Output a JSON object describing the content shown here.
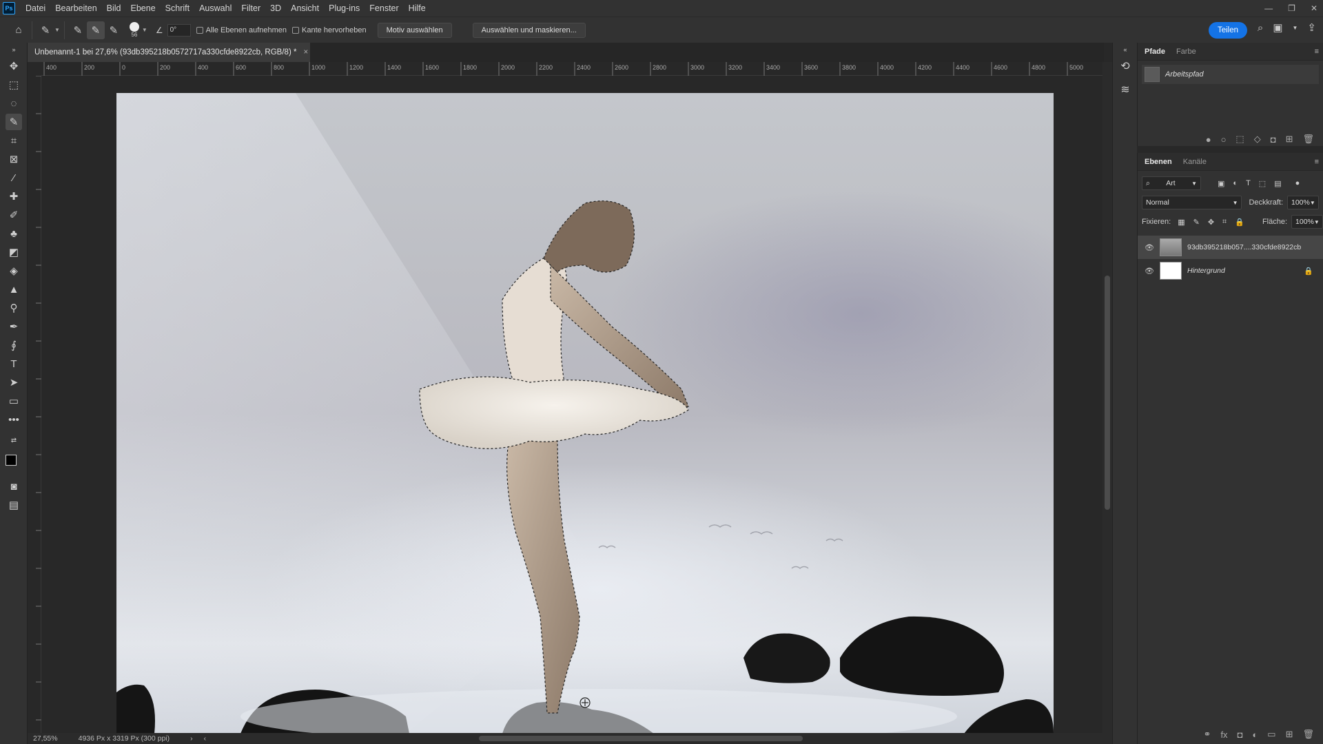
{
  "menubar": {
    "logo": "Ps",
    "items": [
      "Datei",
      "Bearbeiten",
      "Bild",
      "Ebene",
      "Schrift",
      "Auswahl",
      "Filter",
      "3D",
      "Ansicht",
      "Plug-ins",
      "Fenster",
      "Hilfe"
    ]
  },
  "options": {
    "brush_size": "56",
    "angle_value": "0°",
    "sample_all_layers": "Alle Ebenen aufnehmen",
    "enhance_edge": "Kante hervorheben",
    "select_subject": "Motiv auswählen",
    "select_and_mask": "Auswählen und maskieren...",
    "share": "Teilen"
  },
  "document": {
    "tab_title": "Unbenannt-1 bei 27,6% (93db395218b0572717a330cfde8922cb, RGB/8) *",
    "ruler_labels": [
      "400",
      "200",
      "0",
      "200",
      "400",
      "600",
      "800",
      "1000",
      "1200",
      "1400",
      "1600",
      "1800",
      "2000",
      "2200",
      "2400",
      "2600",
      "2800",
      "3000",
      "3200",
      "3400",
      "3600",
      "3800",
      "4000",
      "4200",
      "4400",
      "4600",
      "4800",
      "5000"
    ]
  },
  "status": {
    "zoom": "27,55%",
    "dimensions": "4936 Px x 3319 Px (300 ppi)"
  },
  "paths_panel": {
    "tabs": [
      "Pfade",
      "Farbe"
    ],
    "path_name": "Arbeitspfad"
  },
  "layers_panel": {
    "tabs": [
      "Ebenen",
      "Kanäle"
    ],
    "filter_label": "Art",
    "blend_mode": "Normal",
    "opacity_label": "Deckkraft:",
    "opacity_value": "100%",
    "lock_label": "Fixieren:",
    "fill_label": "Fläche:",
    "fill_value": "100%",
    "layers": [
      {
        "name": "93db395218b057....330cfde8922cb",
        "selected": true
      },
      {
        "name": "Hintergrund",
        "selected": false
      }
    ]
  },
  "colors": {
    "accent": "#1473e6",
    "ui_bg": "#323232",
    "canvas_bg": "#282828"
  }
}
